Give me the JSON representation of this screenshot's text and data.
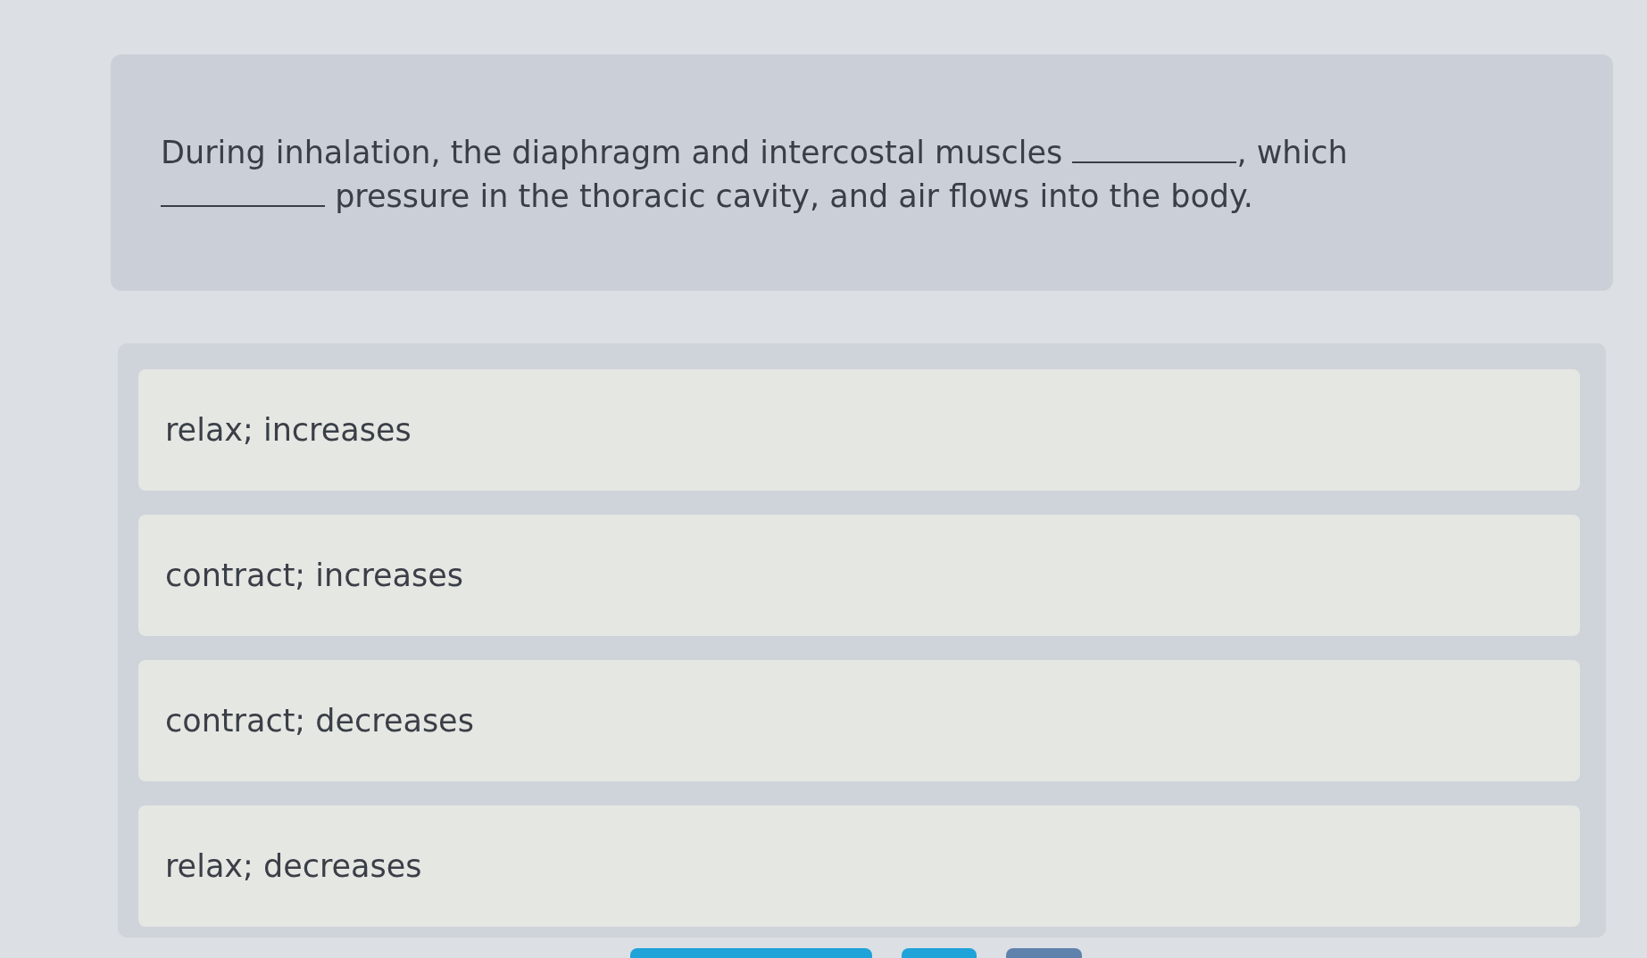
{
  "question": {
    "parts": [
      {
        "kind": "text",
        "text": "During inhalation, the diaphragm and intercostal muscles "
      },
      {
        "kind": "blank"
      },
      {
        "kind": "text",
        "text": ", which "
      },
      {
        "kind": "blank"
      },
      {
        "kind": "text",
        "text": " pressure in the thoracic cavity, and air flows into the body."
      }
    ]
  },
  "options": [
    {
      "text": "relax; increases",
      "selected": false
    },
    {
      "text": "contract; increases",
      "selected": false
    },
    {
      "text": "contract; decreases",
      "selected": false
    },
    {
      "text": "relax; decreases",
      "selected": false
    }
  ],
  "footer_buttons": [
    {
      "kind": "primary"
    },
    {
      "kind": "primary"
    },
    {
      "kind": "secondary"
    }
  ]
}
